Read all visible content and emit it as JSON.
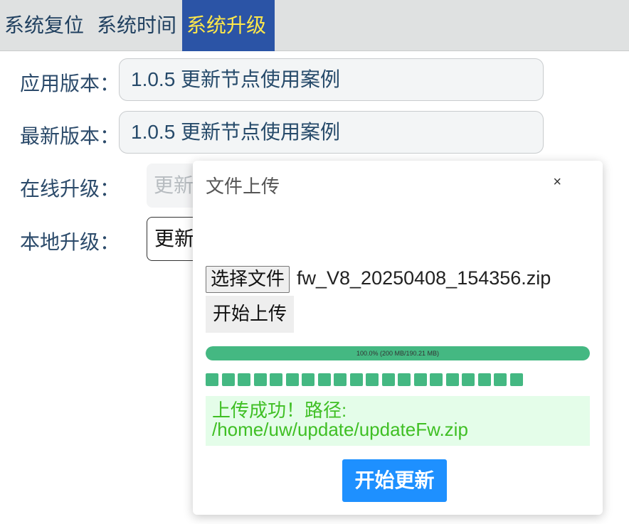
{
  "tabs": [
    {
      "label": "系统复位",
      "active": false
    },
    {
      "label": "系统时间",
      "active": false
    },
    {
      "label": "系统升级",
      "active": true
    }
  ],
  "form": {
    "app_version": {
      "label": "应用版本：",
      "value": "1.0.5 更新节点使用案例"
    },
    "latest_version": {
      "label": "最新版本：",
      "value": "1.0.5 更新节点使用案例"
    },
    "online_upgrade": {
      "label": "在线升级：",
      "button": "更新"
    },
    "local_upgrade": {
      "label": "本地升级：",
      "button": "更新"
    }
  },
  "modal": {
    "title": "文件上传",
    "close": "×",
    "choose_file": "选择文件",
    "file_name": "fw_V8_20250408_154356.zip",
    "start_upload": "开始上传",
    "progress_text": "100.0% (200 MB/190.21 MB)",
    "progress_fraction": 1.0,
    "chunk_count": 20,
    "success_message": "上传成功！路径: /home/uw/update/updateFw.zip",
    "start_update": "开始更新"
  },
  "colors": {
    "tab_active_bg": "#2b54a6",
    "tab_active_text": "#ffe84a",
    "progress": "#44b882",
    "success_text": "#3fbf24",
    "primary_button": "#1e90ff"
  }
}
